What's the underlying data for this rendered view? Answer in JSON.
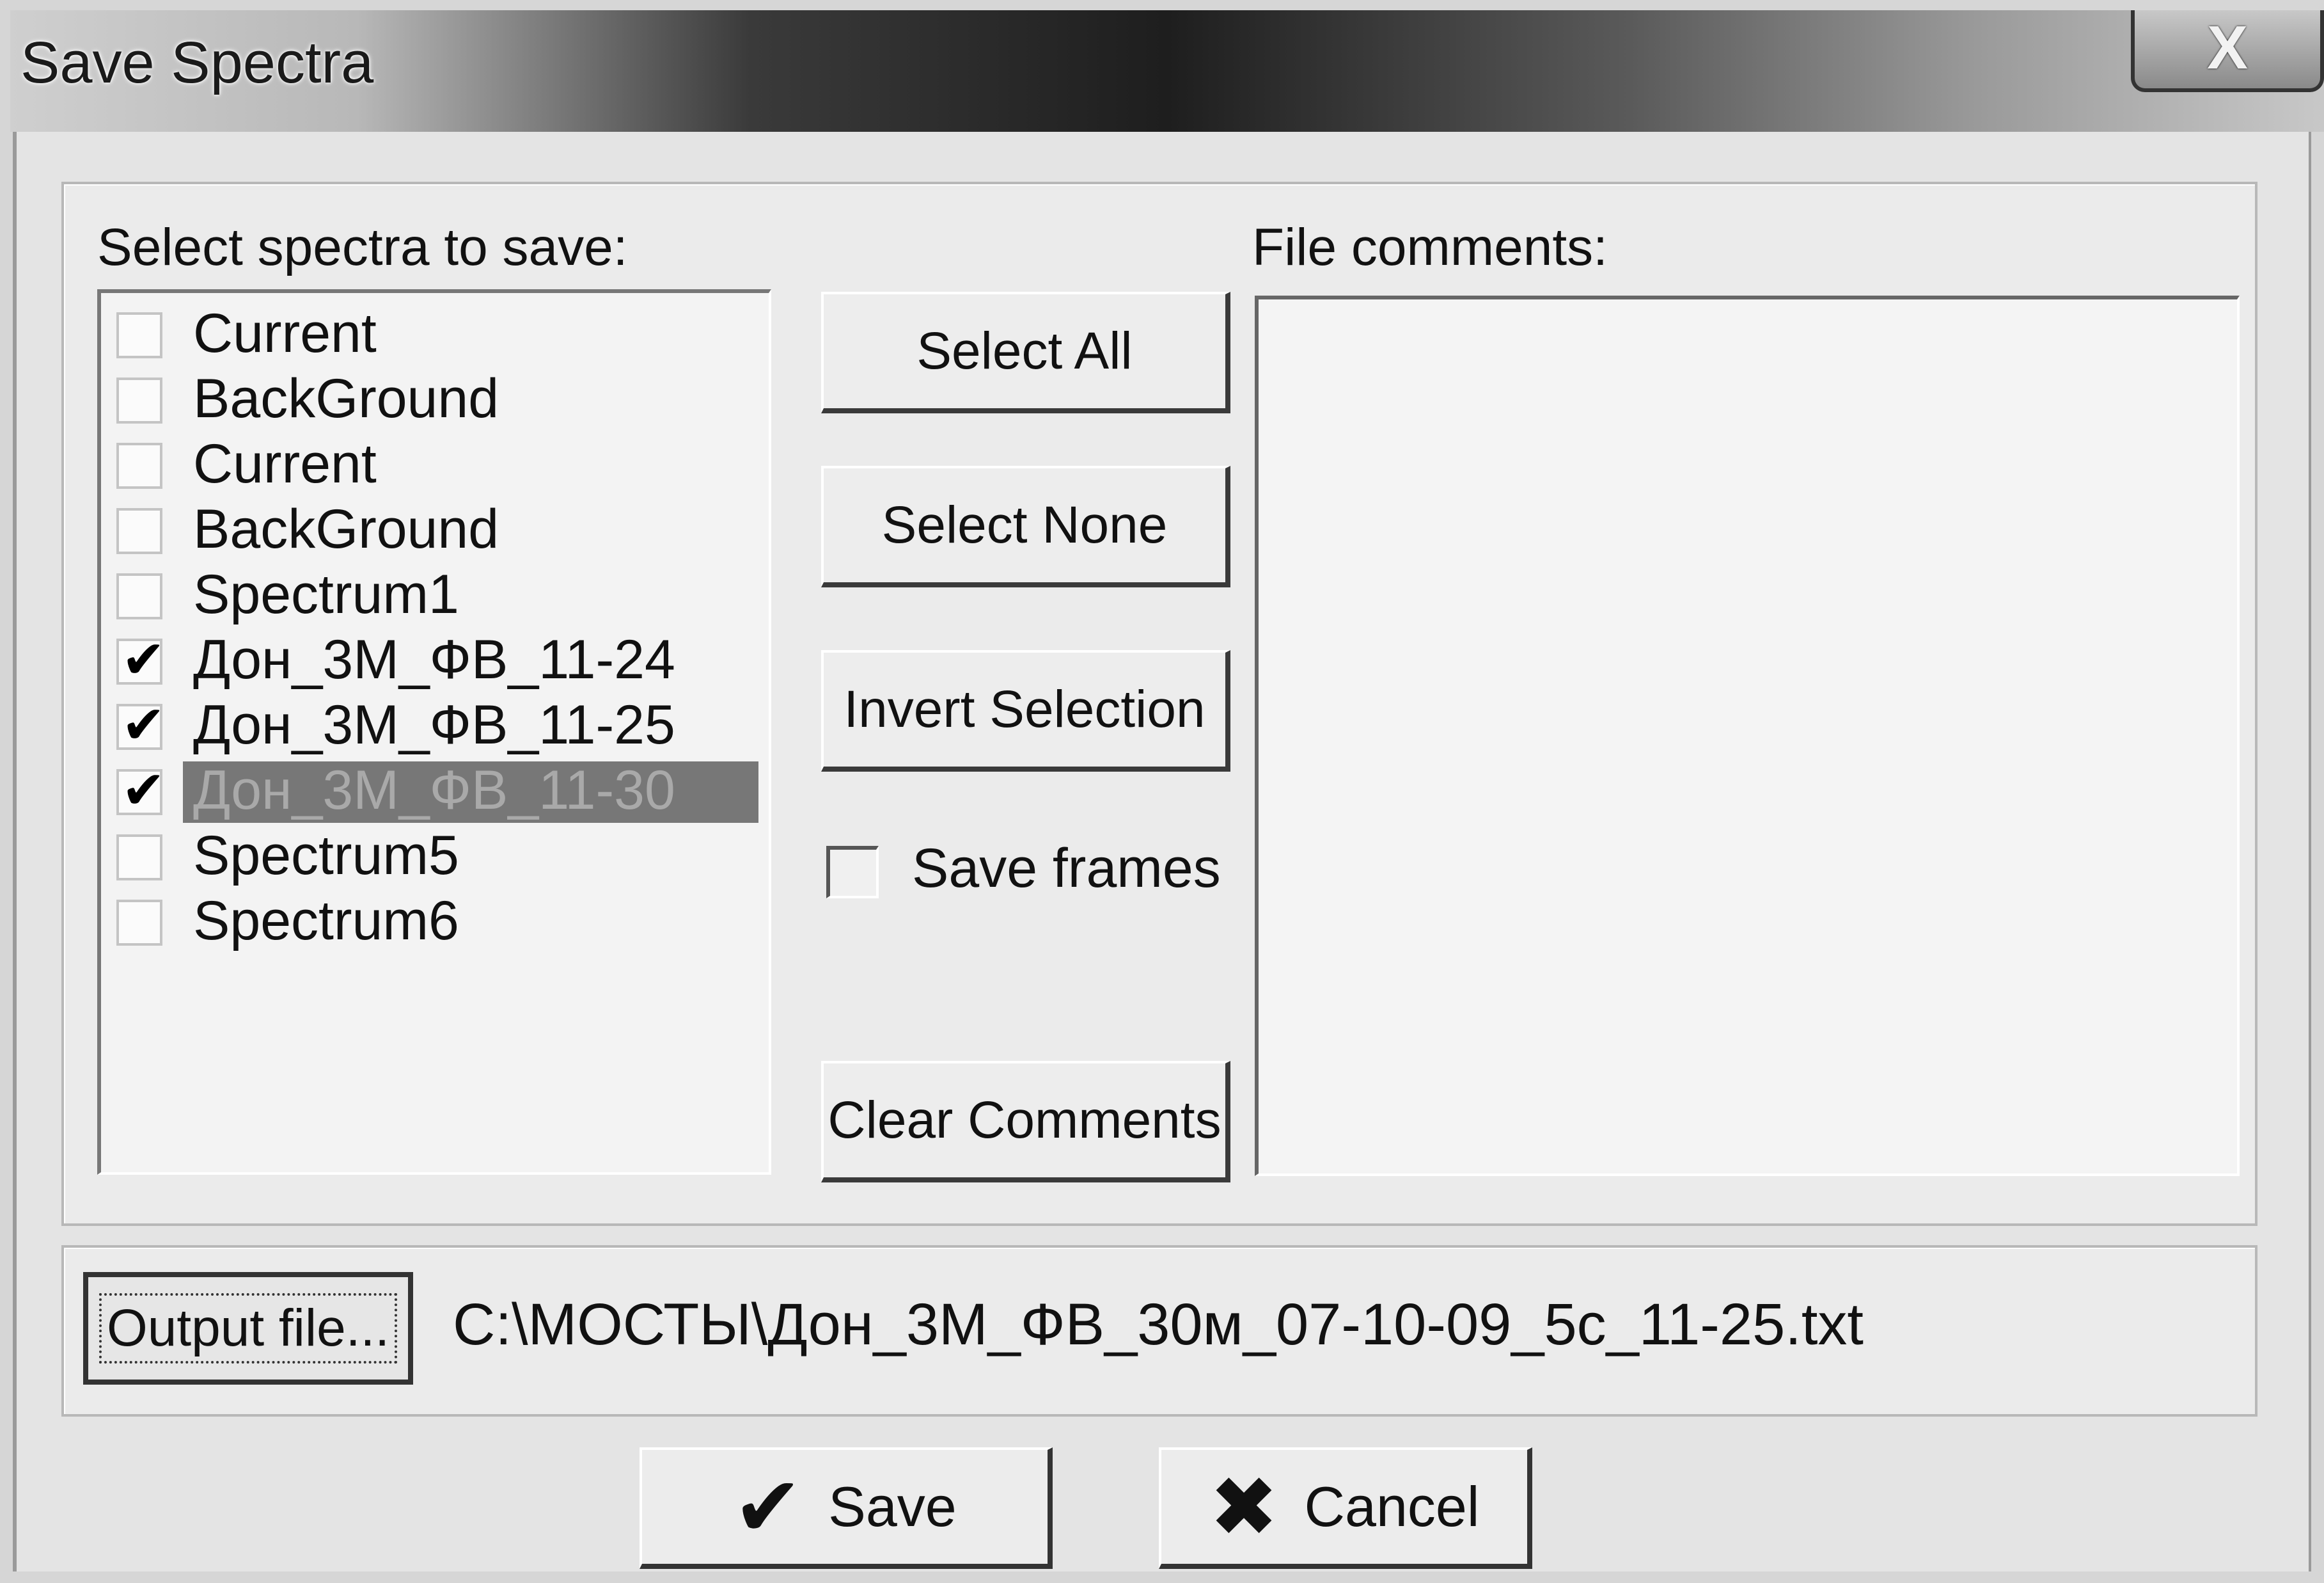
{
  "window": {
    "title": "Save Spectra",
    "close_glyph": "X"
  },
  "left_panel": {
    "label": "Select spectra to save:",
    "items": [
      {
        "label": "Current",
        "checked": false,
        "selected": false
      },
      {
        "label": "BackGround",
        "checked": false,
        "selected": false
      },
      {
        "label": "Current",
        "checked": false,
        "selected": false
      },
      {
        "label": "BackGround",
        "checked": false,
        "selected": false
      },
      {
        "label": "Spectrum1",
        "checked": false,
        "selected": false
      },
      {
        "label": "Дон_3М_ФВ_11-24",
        "checked": true,
        "selected": false
      },
      {
        "label": "Дон_3М_ФВ_11-25",
        "checked": true,
        "selected": false
      },
      {
        "label": "Дон_3М_ФВ_11-30",
        "checked": true,
        "selected": true
      },
      {
        "label": "Spectrum5",
        "checked": false,
        "selected": false
      },
      {
        "label": "Spectrum6",
        "checked": false,
        "selected": false
      }
    ]
  },
  "buttons": {
    "select_all": "Select All",
    "select_none": "Select None",
    "invert_selection": "Invert Selection",
    "save_frames": "Save frames",
    "save_frames_checked": false,
    "clear_comments": "Clear Comments"
  },
  "comments": {
    "label": "File comments:",
    "value": ""
  },
  "output": {
    "button": "Output file...",
    "path": "C:\\МОСТЫ\\Дон_3М_ФВ_30м_07-10-09_5с_11-25.txt"
  },
  "footer": {
    "save": "Save",
    "save_icon": "check-icon",
    "cancel": "Cancel",
    "cancel_icon": "x-icon"
  }
}
